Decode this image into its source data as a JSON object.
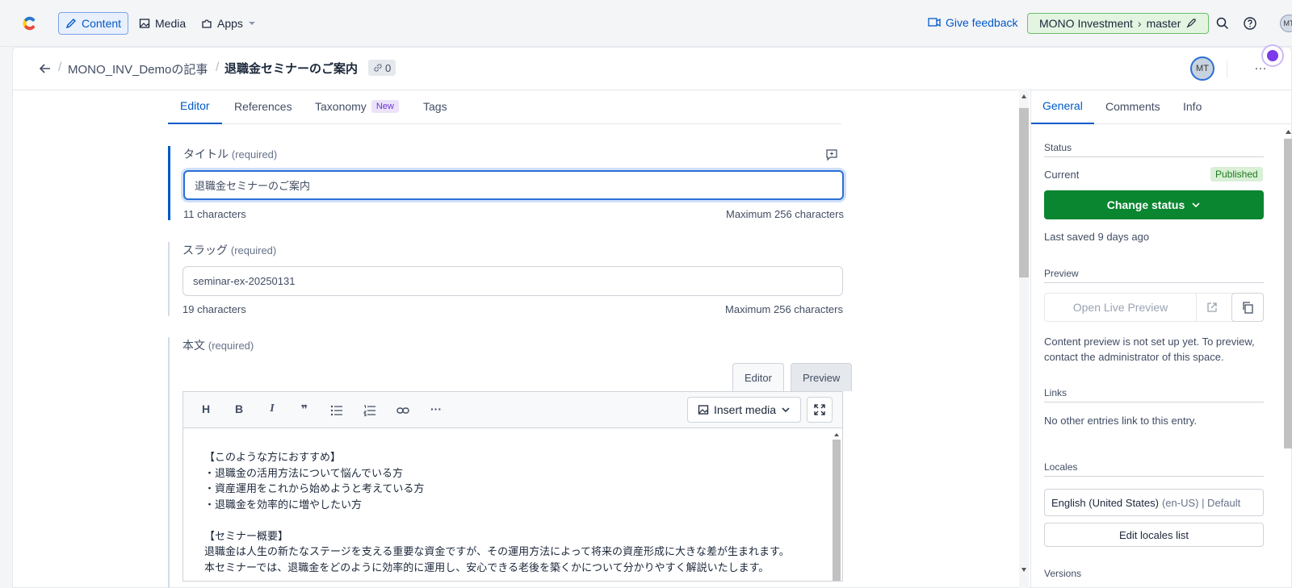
{
  "nav": {
    "content": "Content",
    "media": "Media",
    "apps": "Apps",
    "feedback": "Give feedback",
    "env_space": "MONO Investment",
    "env_branch": "master",
    "avatar": "MT"
  },
  "header": {
    "breadcrumb_parent": "MONO_INV_Demoの記事",
    "entry_title": "退職金セミナーのご案内",
    "link_count": "0",
    "avatar": "MT",
    "more": "…"
  },
  "editor_tabs": {
    "editor": "Editor",
    "references": "References",
    "taxonomy": "Taxonomy",
    "taxonomy_badge": "New",
    "tags": "Tags"
  },
  "title_field": {
    "label": "タイトル",
    "required": "(required)",
    "value": "退職金セミナーのご案内",
    "count": "11 characters",
    "max": "Maximum 256 characters"
  },
  "slug_field": {
    "label": "スラッグ",
    "required": "(required)",
    "value": "seminar-ex-20250131",
    "count": "19 characters",
    "max": "Maximum 256 characters"
  },
  "body_field": {
    "label": "本文",
    "required": "(required)",
    "mode_editor": "Editor",
    "mode_preview": "Preview",
    "toolbar": {
      "heading": "H",
      "bold": "B",
      "italic": "I",
      "quote": "❞",
      "more": "···"
    },
    "insert_media": "Insert media",
    "lines": [
      "【このような方におすすめ】",
      "・退職金の活用方法について悩んでいる方",
      "・資産運用をこれから始めようと考えている方",
      "・退職金を効率的に増やしたい方",
      "",
      "【セミナー概要】",
      "退職金は人生の新たなステージを支える重要な資金ですが、その運用方法によって将来の資産形成に大きな差が生まれます。",
      "本セミナーでは、退職金をどのように効率的に運用し、安心できる老後を築くかについて分かりやすく解説いたします。"
    ]
  },
  "sidebar": {
    "tabs": [
      "General",
      "Comments",
      "Info"
    ],
    "status_heading": "Status",
    "current_label": "Current",
    "status_badge": "Published",
    "change_status": "Change status",
    "last_saved": "Last saved 9 days ago",
    "preview_heading": "Preview",
    "open_live_preview": "Open Live Preview",
    "preview_note_1": "Content preview is not set up yet. To preview,",
    "preview_note_2": "contact the administrator of this space.",
    "links_heading": "Links",
    "links_text": "No other entries link to this entry.",
    "locales_heading": "Locales",
    "locale_name": "English (United States)",
    "locale_suffix": "(en-US) | Default",
    "edit_locales": "Edit locales list",
    "versions_heading": "Versions"
  },
  "colors": {
    "accent": "#0059c8",
    "status_button": "#0a8530",
    "published_bg": "#d9f0d6",
    "env_bg": "#e3f4e1"
  }
}
